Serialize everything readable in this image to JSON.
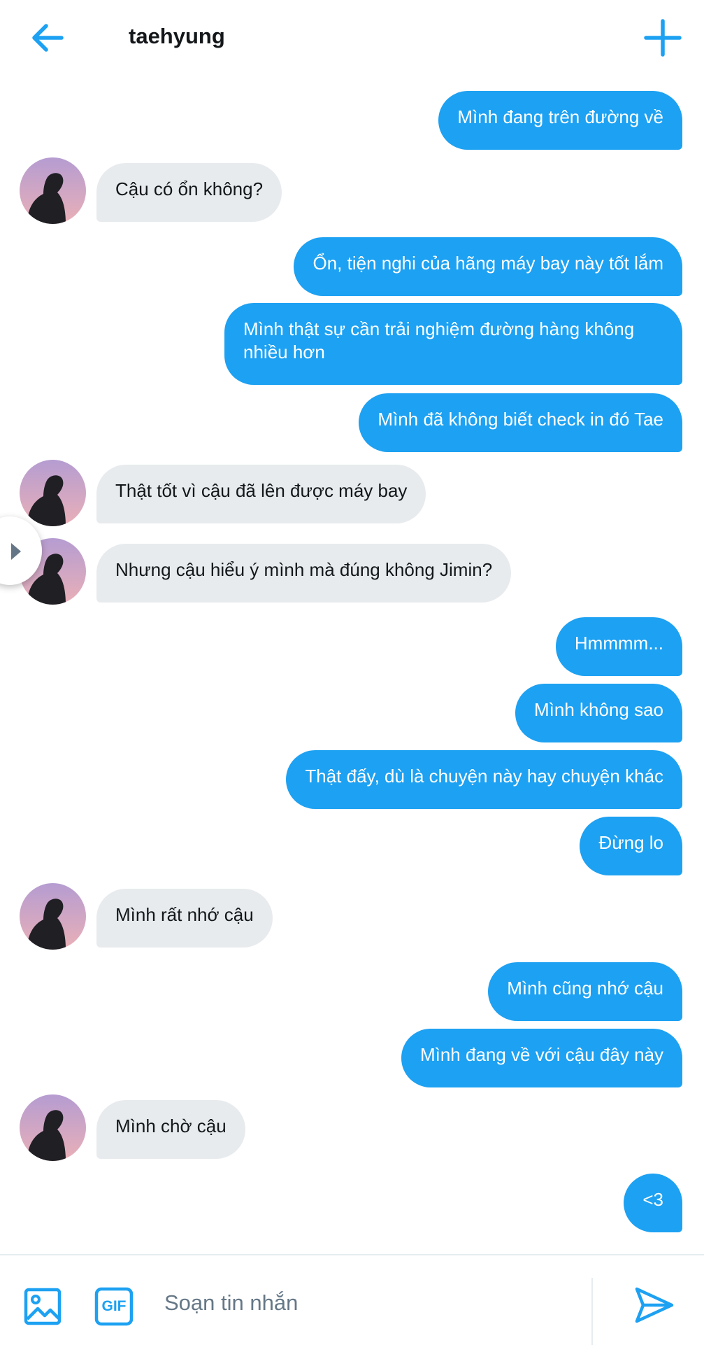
{
  "header": {
    "title": "taehyung",
    "back_icon": "arrow-left-icon",
    "new_icon": "plus-icon"
  },
  "messages": [
    {
      "from": "me",
      "text": "Mình đang trên đường về"
    },
    {
      "from": "taehyung",
      "text": "Cậu có ổn không?"
    },
    {
      "from": "me",
      "text": "Ổn, tiện nghi của hãng máy bay này tốt lắm"
    },
    {
      "from": "me",
      "text": "Mình thật sự cần trải nghiệm đường hàng không nhiều hơn"
    },
    {
      "from": "me",
      "text": "Mình đã không biết check in đó Tae"
    },
    {
      "from": "taehyung",
      "text": "Thật tốt vì cậu đã lên được máy bay"
    },
    {
      "from": "taehyung",
      "text": "Nhưng cậu hiểu ý mình mà đúng không Jimin?"
    },
    {
      "from": "me",
      "text": "Hmmmm..."
    },
    {
      "from": "me",
      "text": "Mình không sao"
    },
    {
      "from": "me",
      "text": "Thật đấy, dù là chuyện này hay chuyện khác"
    },
    {
      "from": "me",
      "text": "Đừng lo"
    },
    {
      "from": "taehyung",
      "text": "Mình rất nhớ cậu"
    },
    {
      "from": "me",
      "text": "Mình cũng nhớ cậu"
    },
    {
      "from": "me",
      "text": "Mình đang về với cậu đây này"
    },
    {
      "from": "taehyung",
      "text": "Mình chờ cậu"
    },
    {
      "from": "me",
      "text": "<3"
    }
  ],
  "composer": {
    "placeholder": "Soạn tin nhắn",
    "image_icon": "image-icon",
    "gif_label": "GIF",
    "send_icon": "send-icon"
  },
  "colors": {
    "accent": "#1da1f2",
    "incoming_bubble": "#e8ebee",
    "text": "#14171a",
    "placeholder": "#657786"
  }
}
